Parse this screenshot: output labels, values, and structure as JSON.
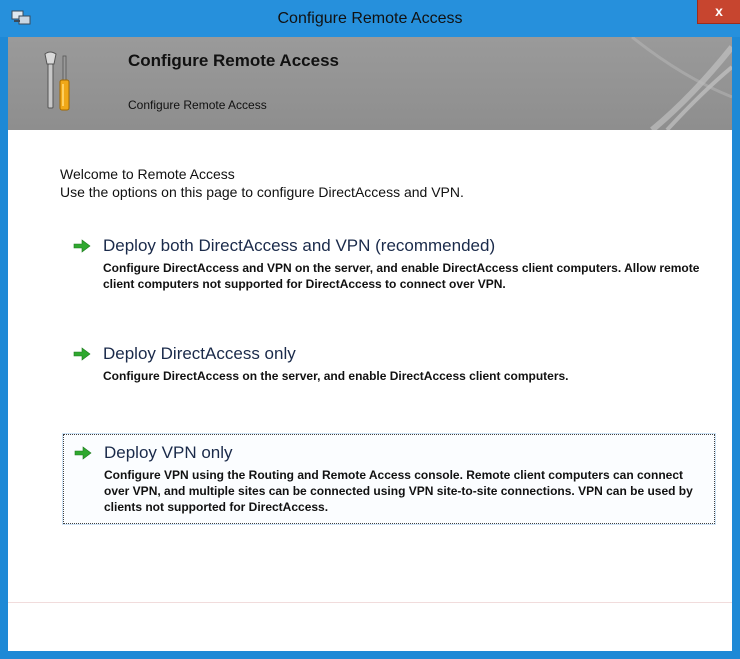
{
  "window": {
    "title": "Configure Remote Access",
    "close_label": "x",
    "accent_color": "#1e89d6",
    "close_color": "#c7452f"
  },
  "banner": {
    "title": "Configure Remote Access",
    "subtitle": "Configure Remote Access",
    "icon": "tools-icon"
  },
  "welcome": {
    "heading": "Welcome to Remote Access",
    "text": "Use the options on this page to configure DirectAccess and VPN."
  },
  "options": [
    {
      "title": "Deploy both DirectAccess and VPN (recommended)",
      "description": "Configure DirectAccess and VPN on the server, and enable DirectAccess client computers. Allow remote client computers not supported for DirectAccess to connect over VPN.",
      "icon": "green-arrow-icon",
      "focused": false
    },
    {
      "title": "Deploy DirectAccess only",
      "description": "Configure DirectAccess on the server, and enable DirectAccess client computers.",
      "icon": "green-arrow-icon",
      "focused": false
    },
    {
      "title": "Deploy VPN only",
      "description": "Configure VPN using the Routing and Remote Access console. Remote client computers can connect over VPN, and multiple sites can be connected using VPN site-to-site connections. VPN can be used by clients not supported for DirectAccess.",
      "icon": "green-arrow-icon",
      "focused": true
    }
  ]
}
